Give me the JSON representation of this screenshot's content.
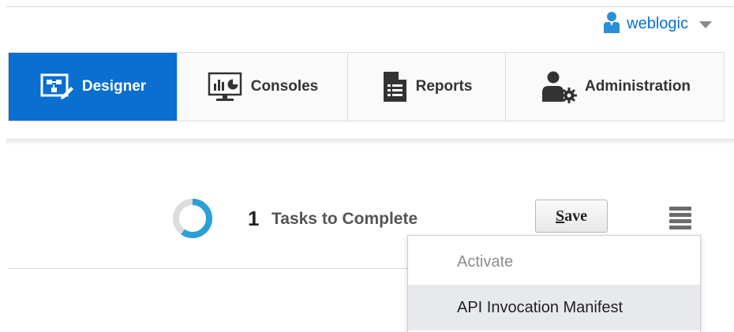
{
  "user": {
    "name": "weblogic",
    "icon": "user-icon"
  },
  "nav": {
    "items": [
      {
        "label": "Designer",
        "icon": "designer-icon",
        "active": true
      },
      {
        "label": "Consoles",
        "icon": "consoles-icon",
        "active": false
      },
      {
        "label": "Reports",
        "icon": "reports-icon",
        "active": false
      },
      {
        "label": "Administration",
        "icon": "administration-icon",
        "active": false
      }
    ]
  },
  "tasks": {
    "count": "1",
    "label": "Tasks to Complete",
    "progress": 0.6
  },
  "toolbar": {
    "save_mnemonic": "S",
    "save_rest": "ave"
  },
  "menu": {
    "items": [
      {
        "label": "Activate",
        "disabled": true
      },
      {
        "label": "API Invocation Manifest",
        "disabled": false
      }
    ]
  },
  "colors": {
    "accent": "#0a6fcf",
    "link": "#0572ce",
    "ring_fill": "#2a9fd8",
    "ring_track": "#dddddd"
  }
}
